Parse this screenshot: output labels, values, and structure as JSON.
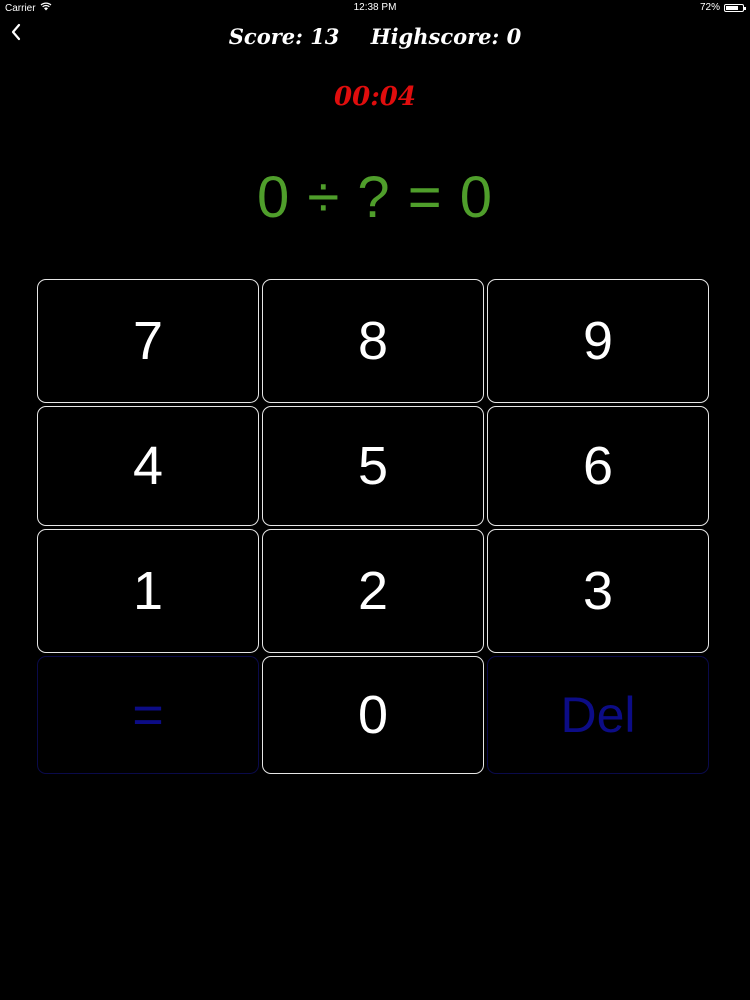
{
  "status_bar": {
    "carrier": "Carrier",
    "time": "12:38 PM",
    "battery": "72%",
    "battery_level": 0.72
  },
  "header": {
    "score": "Score: 13",
    "highscore": "Highscore: 0"
  },
  "timer": "00:04",
  "equation": "0 ÷ ? = 0",
  "colors": {
    "timer": "#e00d0d",
    "equation": "#4f9e2b",
    "disabled_key": "#0c0c86",
    "key_border": "#e6e6e6"
  },
  "keypad": {
    "keys": [
      {
        "label": "7",
        "enabled": true
      },
      {
        "label": "8",
        "enabled": true
      },
      {
        "label": "9",
        "enabled": true
      },
      {
        "label": "4",
        "enabled": true
      },
      {
        "label": "5",
        "enabled": true
      },
      {
        "label": "6",
        "enabled": true
      },
      {
        "label": "1",
        "enabled": true
      },
      {
        "label": "2",
        "enabled": true
      },
      {
        "label": "3",
        "enabled": true
      },
      {
        "label": "=",
        "enabled": false
      },
      {
        "label": "0",
        "enabled": true
      },
      {
        "label": "Del",
        "enabled": false
      }
    ]
  }
}
